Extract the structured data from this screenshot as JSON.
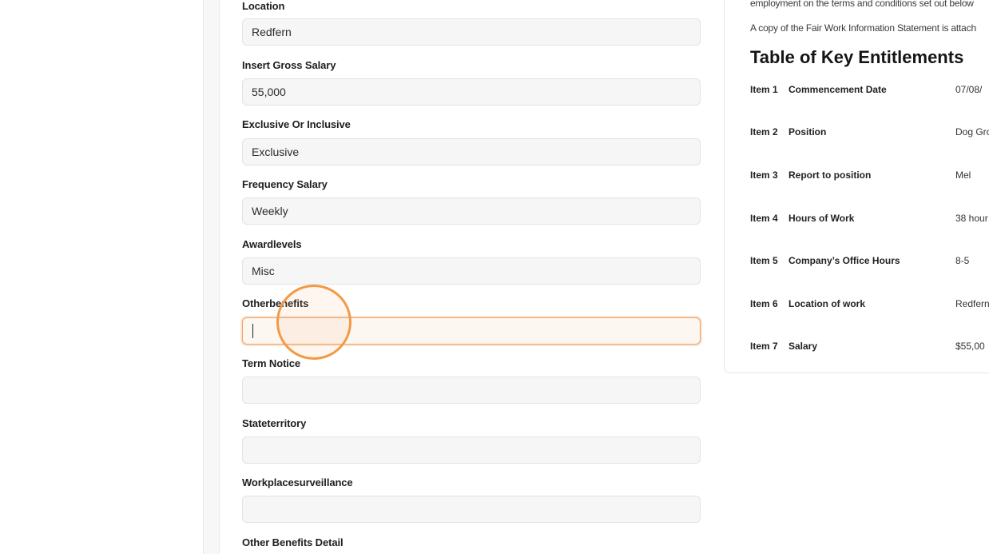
{
  "form": {
    "fields": [
      {
        "label": "Location",
        "value": "Redfern"
      },
      {
        "label": "Insert Gross Salary",
        "value": "55,000"
      },
      {
        "label": "Exclusive Or Inclusive",
        "value": "Exclusive"
      },
      {
        "label": "Frequency Salary",
        "value": "Weekly"
      },
      {
        "label": "Awardlevels",
        "value": "Misc"
      },
      {
        "label": "Otherbenefits",
        "value": ""
      },
      {
        "label": "Term Notice",
        "value": ""
      },
      {
        "label": "Stateterritory",
        "value": ""
      },
      {
        "label": "Workplacesurveillance",
        "value": ""
      },
      {
        "label": "Other Benefits Detail",
        "value": ""
      }
    ]
  },
  "document": {
    "intro_line": "employment on the terms and conditions set out below",
    "fair_work_line": "A copy of the Fair Work Information Statement is attach",
    "heading": "Table of Key Entitlements",
    "entitlements": [
      {
        "item": "Item 1",
        "name": "Commencement Date",
        "value": "07/08/"
      },
      {
        "item": "Item 2",
        "name": "Position",
        "value": "Dog Gro"
      },
      {
        "item": "Item 3",
        "name": "Report to position",
        "value": "Mel"
      },
      {
        "item": "Item 4",
        "name": "Hours of Work",
        "value": "38 hour"
      },
      {
        "item": "Item 5",
        "name": "Company’s Office Hours",
        "value": "8-5"
      },
      {
        "item": "Item 6",
        "name": "Location of work",
        "value": "Redfern"
      },
      {
        "item": "Item 7",
        "name": "Salary",
        "value": "$55,00"
      }
    ]
  },
  "colors": {
    "focus_ring": "#f0a060",
    "click_indicator": "#f29a45"
  }
}
